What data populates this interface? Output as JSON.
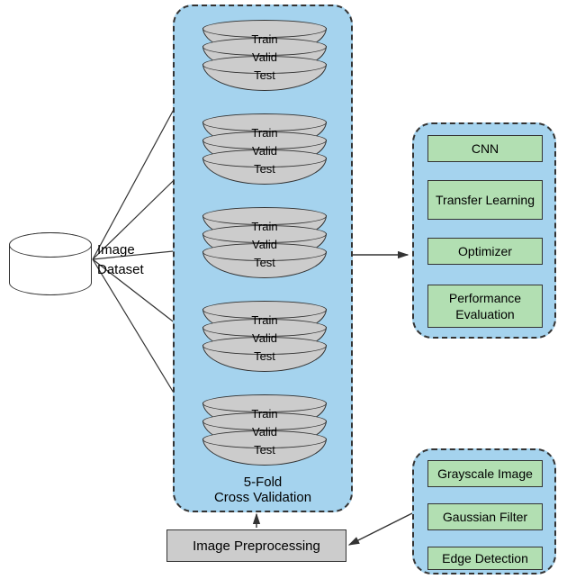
{
  "dataset_label_line1": "Image",
  "dataset_label_line2": "Dataset",
  "kfold": {
    "splits": [
      {
        "train": "Train",
        "valid": "Valid",
        "test": "Test"
      },
      {
        "train": "Train",
        "valid": "Valid",
        "test": "Test"
      },
      {
        "train": "Train",
        "valid": "Valid",
        "test": "Test"
      },
      {
        "train": "Train",
        "valid": "Valid",
        "test": "Test"
      },
      {
        "train": "Train",
        "valid": "Valid",
        "test": "Test"
      }
    ],
    "label_line1": "5-Fold",
    "label_line2": "Cross Validation"
  },
  "pipeline": {
    "steps": [
      "CNN",
      "Transfer Learning",
      "Optimizer",
      "Performance Evaluation"
    ]
  },
  "preprocess_input_label": "Image Preprocessing",
  "preprocess_box": {
    "steps": [
      "Grayscale Image",
      "Gaussian Filter",
      "Edge Detection"
    ]
  }
}
